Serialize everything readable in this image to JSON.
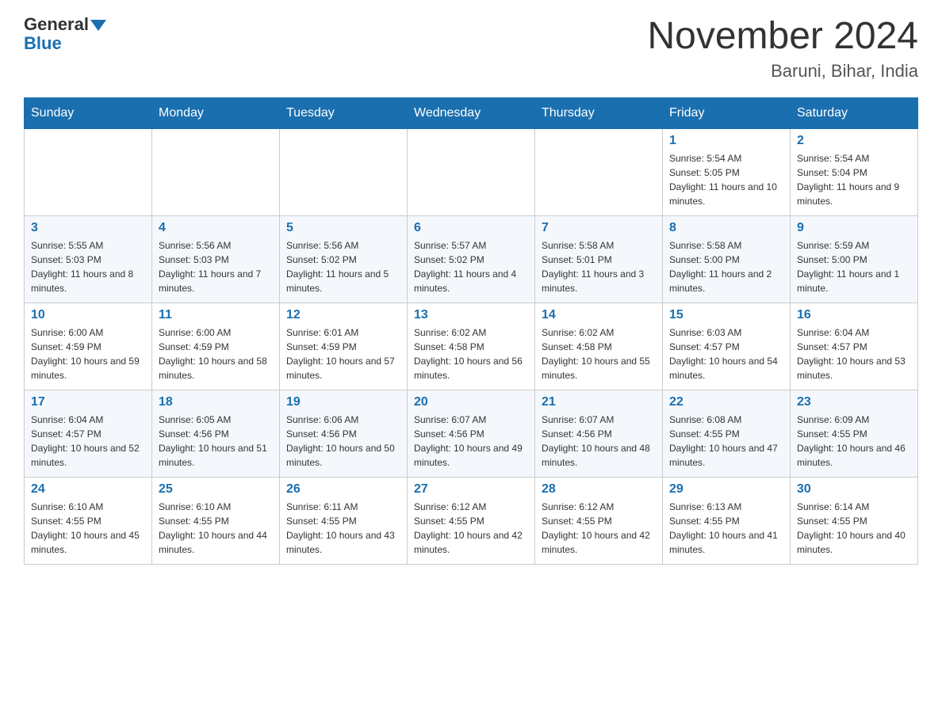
{
  "header": {
    "logo_main": "General",
    "logo_sub": "Blue",
    "month_year": "November 2024",
    "location": "Baruni, Bihar, India"
  },
  "days_of_week": [
    "Sunday",
    "Monday",
    "Tuesday",
    "Wednesday",
    "Thursday",
    "Friday",
    "Saturday"
  ],
  "weeks": [
    [
      {
        "day": "",
        "info": ""
      },
      {
        "day": "",
        "info": ""
      },
      {
        "day": "",
        "info": ""
      },
      {
        "day": "",
        "info": ""
      },
      {
        "day": "",
        "info": ""
      },
      {
        "day": "1",
        "info": "Sunrise: 5:54 AM\nSunset: 5:05 PM\nDaylight: 11 hours and 10 minutes."
      },
      {
        "day": "2",
        "info": "Sunrise: 5:54 AM\nSunset: 5:04 PM\nDaylight: 11 hours and 9 minutes."
      }
    ],
    [
      {
        "day": "3",
        "info": "Sunrise: 5:55 AM\nSunset: 5:03 PM\nDaylight: 11 hours and 8 minutes."
      },
      {
        "day": "4",
        "info": "Sunrise: 5:56 AM\nSunset: 5:03 PM\nDaylight: 11 hours and 7 minutes."
      },
      {
        "day": "5",
        "info": "Sunrise: 5:56 AM\nSunset: 5:02 PM\nDaylight: 11 hours and 5 minutes."
      },
      {
        "day": "6",
        "info": "Sunrise: 5:57 AM\nSunset: 5:02 PM\nDaylight: 11 hours and 4 minutes."
      },
      {
        "day": "7",
        "info": "Sunrise: 5:58 AM\nSunset: 5:01 PM\nDaylight: 11 hours and 3 minutes."
      },
      {
        "day": "8",
        "info": "Sunrise: 5:58 AM\nSunset: 5:00 PM\nDaylight: 11 hours and 2 minutes."
      },
      {
        "day": "9",
        "info": "Sunrise: 5:59 AM\nSunset: 5:00 PM\nDaylight: 11 hours and 1 minute."
      }
    ],
    [
      {
        "day": "10",
        "info": "Sunrise: 6:00 AM\nSunset: 4:59 PM\nDaylight: 10 hours and 59 minutes."
      },
      {
        "day": "11",
        "info": "Sunrise: 6:00 AM\nSunset: 4:59 PM\nDaylight: 10 hours and 58 minutes."
      },
      {
        "day": "12",
        "info": "Sunrise: 6:01 AM\nSunset: 4:59 PM\nDaylight: 10 hours and 57 minutes."
      },
      {
        "day": "13",
        "info": "Sunrise: 6:02 AM\nSunset: 4:58 PM\nDaylight: 10 hours and 56 minutes."
      },
      {
        "day": "14",
        "info": "Sunrise: 6:02 AM\nSunset: 4:58 PM\nDaylight: 10 hours and 55 minutes."
      },
      {
        "day": "15",
        "info": "Sunrise: 6:03 AM\nSunset: 4:57 PM\nDaylight: 10 hours and 54 minutes."
      },
      {
        "day": "16",
        "info": "Sunrise: 6:04 AM\nSunset: 4:57 PM\nDaylight: 10 hours and 53 minutes."
      }
    ],
    [
      {
        "day": "17",
        "info": "Sunrise: 6:04 AM\nSunset: 4:57 PM\nDaylight: 10 hours and 52 minutes."
      },
      {
        "day": "18",
        "info": "Sunrise: 6:05 AM\nSunset: 4:56 PM\nDaylight: 10 hours and 51 minutes."
      },
      {
        "day": "19",
        "info": "Sunrise: 6:06 AM\nSunset: 4:56 PM\nDaylight: 10 hours and 50 minutes."
      },
      {
        "day": "20",
        "info": "Sunrise: 6:07 AM\nSunset: 4:56 PM\nDaylight: 10 hours and 49 minutes."
      },
      {
        "day": "21",
        "info": "Sunrise: 6:07 AM\nSunset: 4:56 PM\nDaylight: 10 hours and 48 minutes."
      },
      {
        "day": "22",
        "info": "Sunrise: 6:08 AM\nSunset: 4:55 PM\nDaylight: 10 hours and 47 minutes."
      },
      {
        "day": "23",
        "info": "Sunrise: 6:09 AM\nSunset: 4:55 PM\nDaylight: 10 hours and 46 minutes."
      }
    ],
    [
      {
        "day": "24",
        "info": "Sunrise: 6:10 AM\nSunset: 4:55 PM\nDaylight: 10 hours and 45 minutes."
      },
      {
        "day": "25",
        "info": "Sunrise: 6:10 AM\nSunset: 4:55 PM\nDaylight: 10 hours and 44 minutes."
      },
      {
        "day": "26",
        "info": "Sunrise: 6:11 AM\nSunset: 4:55 PM\nDaylight: 10 hours and 43 minutes."
      },
      {
        "day": "27",
        "info": "Sunrise: 6:12 AM\nSunset: 4:55 PM\nDaylight: 10 hours and 42 minutes."
      },
      {
        "day": "28",
        "info": "Sunrise: 6:12 AM\nSunset: 4:55 PM\nDaylight: 10 hours and 42 minutes."
      },
      {
        "day": "29",
        "info": "Sunrise: 6:13 AM\nSunset: 4:55 PM\nDaylight: 10 hours and 41 minutes."
      },
      {
        "day": "30",
        "info": "Sunrise: 6:14 AM\nSunset: 4:55 PM\nDaylight: 10 hours and 40 minutes."
      }
    ]
  ]
}
